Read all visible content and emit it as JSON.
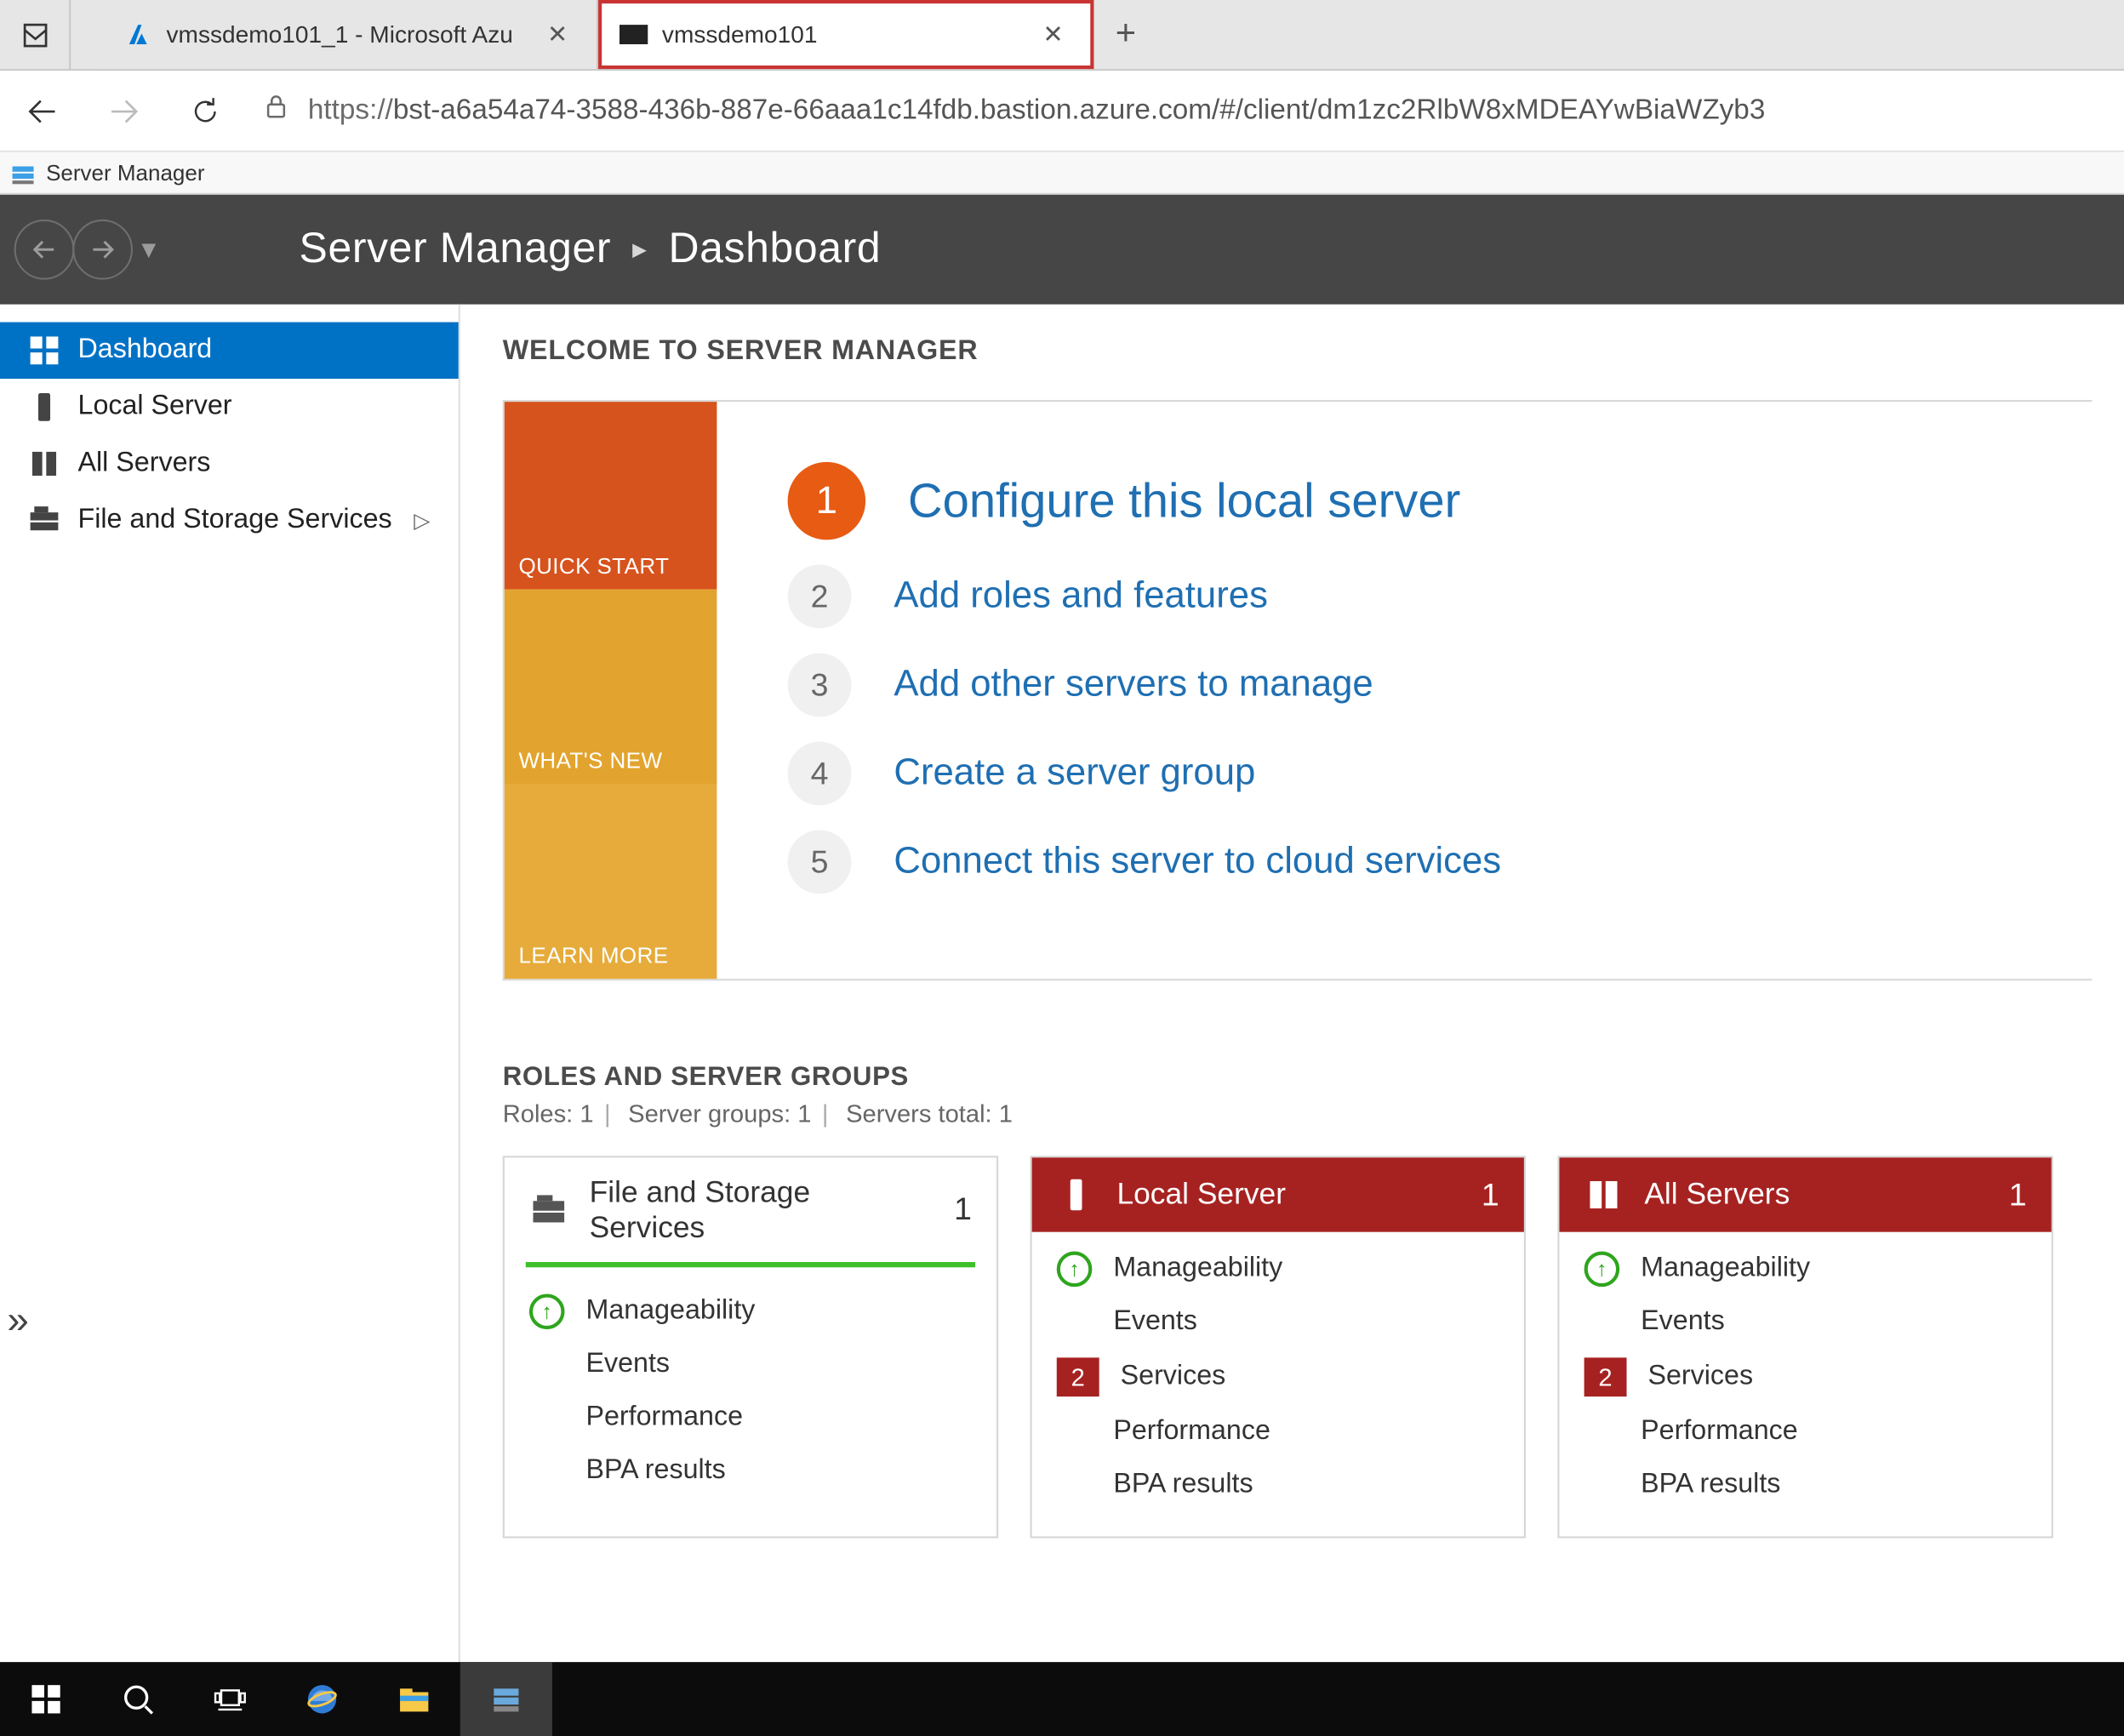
{
  "browser": {
    "tabs": [
      {
        "title": "vmssdemo101_1 - Microsoft Azu",
        "favicon": "azure"
      },
      {
        "title": "vmssdemo101",
        "favicon": "terminal"
      }
    ],
    "url_scheme": "https://",
    "url_rest": "bst-a6a54a74-3588-436b-887e-66aaa1c14fdb.bastion.azure.com/#/client/dm1zc2RlbW8xMDEAYwBiaWZyb3"
  },
  "remote_caption": "Server Manager",
  "header": {
    "app": "Server Manager",
    "crumb": "Dashboard"
  },
  "sidebar": {
    "items": [
      {
        "label": "Dashboard",
        "icon": "dashboard"
      },
      {
        "label": "Local Server",
        "icon": "server"
      },
      {
        "label": "All Servers",
        "icon": "servers"
      },
      {
        "label": "File and Storage Services",
        "icon": "file",
        "caret": true
      }
    ]
  },
  "welcome": "WELCOME TO SERVER MANAGER",
  "qs": {
    "tile_quick": "QUICK START",
    "tile_new": "WHAT'S NEW",
    "tile_learn": "LEARN MORE",
    "steps": [
      {
        "n": "1",
        "label": "Configure this local server",
        "primary": true
      },
      {
        "n": "2",
        "label": "Add roles and features"
      },
      {
        "n": "3",
        "label": "Add other servers to manage"
      },
      {
        "n": "4",
        "label": "Create a server group"
      },
      {
        "n": "5",
        "label": "Connect this server to cloud services"
      }
    ]
  },
  "roles": {
    "heading": "ROLES AND SERVER GROUPS",
    "sub_roles": "Roles: 1",
    "sub_groups": "Server groups: 1",
    "sub_total": "Servers total: 1",
    "tiles": [
      {
        "title": "File and Storage Services",
        "count": "1",
        "style": "green",
        "rows": [
          {
            "status": "up",
            "label": "Manageability"
          },
          {
            "label": "Events"
          },
          {
            "label": "Performance"
          },
          {
            "label": "BPA results"
          }
        ]
      },
      {
        "title": "Local Server",
        "count": "1",
        "style": "red",
        "rows": [
          {
            "status": "up",
            "label": "Manageability"
          },
          {
            "label": "Events"
          },
          {
            "badge": "2",
            "label": "Services"
          },
          {
            "label": "Performance"
          },
          {
            "label": "BPA results"
          }
        ]
      },
      {
        "title": "All Servers",
        "count": "1",
        "style": "red",
        "rows": [
          {
            "status": "up",
            "label": "Manageability"
          },
          {
            "label": "Events"
          },
          {
            "badge": "2",
            "label": "Services"
          },
          {
            "label": "Performance"
          },
          {
            "label": "BPA results"
          }
        ]
      }
    ]
  }
}
